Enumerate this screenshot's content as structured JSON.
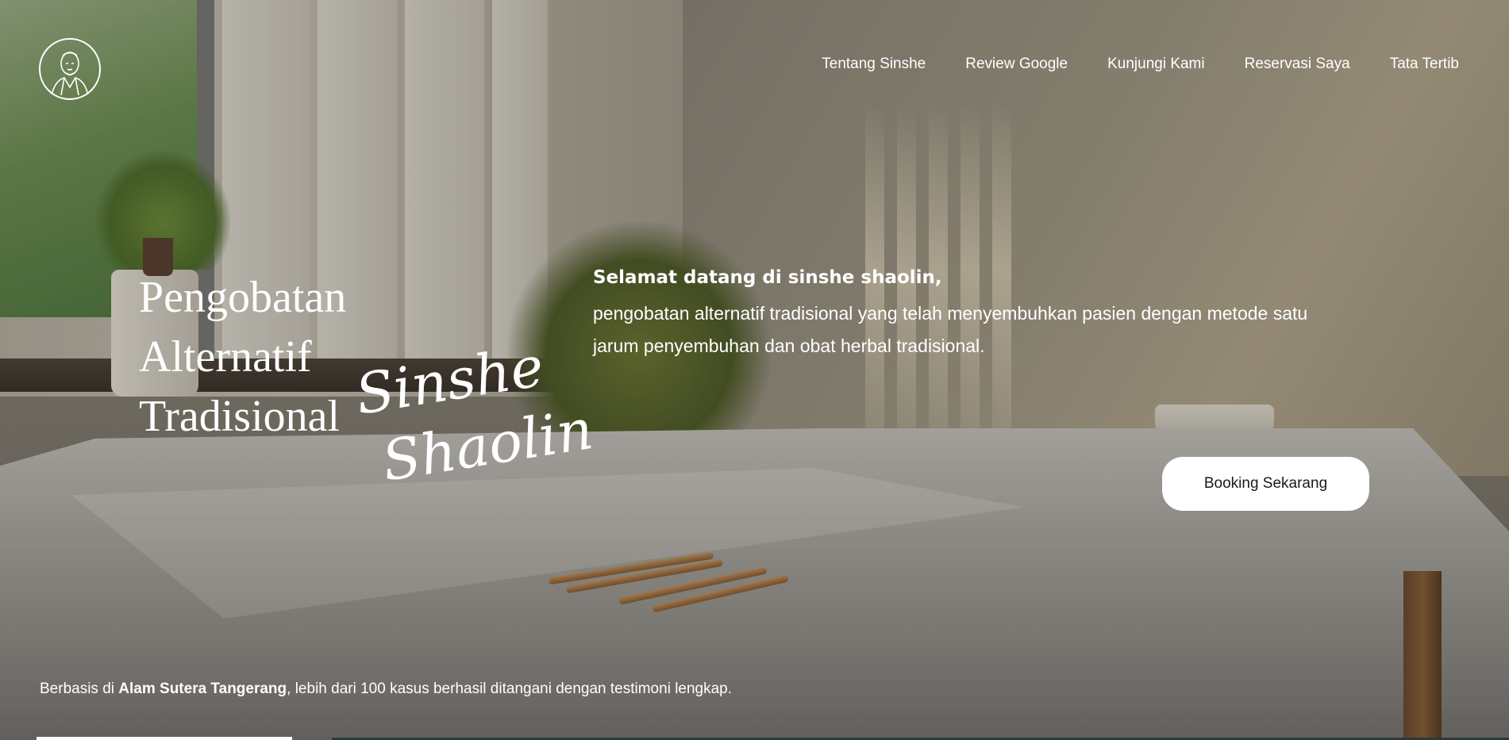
{
  "header": {
    "logo_icon": "shaolin-monk-portrait-icon",
    "nav": [
      {
        "label": "Tentang Sinshe"
      },
      {
        "label": "Review Google"
      },
      {
        "label": "Kunjungi Kami"
      },
      {
        "label": "Reservasi Saya"
      },
      {
        "label": "Tata Tertib"
      }
    ]
  },
  "hero": {
    "title_lines": [
      "Pengobatan",
      "Alternatif",
      "Tradisional"
    ],
    "script_lines": [
      "Sinshe",
      "Shaolin"
    ],
    "welcome_bold": "Selamat datang di sinshe shaolin,",
    "welcome_body": "pengobatan alternatif tradisional yang telah menyembuhkan pasien dengan metode satu jarum penyembuhan dan obat herbal tradisional.",
    "cta_label": "Booking Sekarang"
  },
  "footer": {
    "prefix": "Berbasis di ",
    "location": "Alam Sutera Tangerang",
    "suffix": ", lebih dari 100 kasus berhasil ditangani dengan testimoni lengkap."
  },
  "colors": {
    "text": "#ffffff",
    "button_bg": "#ffffff",
    "button_text": "#1a1a1a"
  }
}
